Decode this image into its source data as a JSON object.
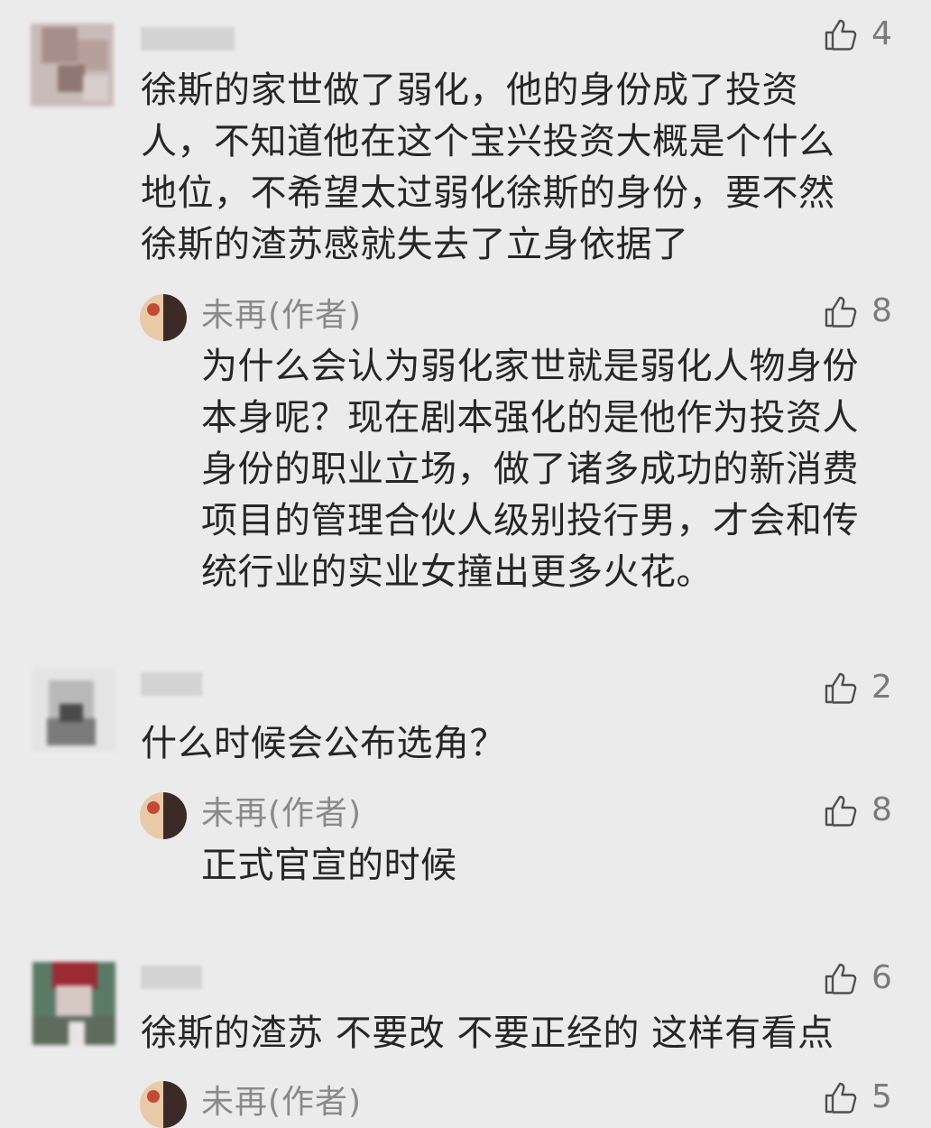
{
  "comments": [
    {
      "text": "徐斯的家世做了弱化，他的身份成了投资人，不知道他在这个宝兴投资大概是个什么地位，不希望太过弱化徐斯的身份，要不然徐斯的渣苏感就失去了立身依据了",
      "lines": [
        "徐斯的家世做了弱化，他的身份成了投资",
        "人，不知道他在这个宝兴投资大概是个什么",
        "地位，不希望太过弱化徐斯的身份，要不然",
        "徐斯的渣苏感就失去了立身依据了"
      ],
      "likes": "4",
      "reply": {
        "author": "未再(作者)",
        "lines": [
          "为什么会认为弱化家世就是弱化人物身份",
          "本身呢？现在剧本强化的是他作为投资人",
          "身份的职业立场，做了诸多成功的新消费",
          "项目的管理合伙人级别投行男，才会和传",
          "统行业的实业女撞出更多火花。"
        ],
        "likes": "8"
      }
    },
    {
      "text": "什么时候会公布选角？",
      "likes": "2",
      "reply": {
        "author": "未再(作者)",
        "text": "正式官宣的时候",
        "likes": "8"
      }
    },
    {
      "text": "徐斯的渣苏 不要改 不要正经的 这样有看点",
      "likes": "6",
      "reply": {
        "author": "未再(作者)",
        "likes": "5"
      }
    }
  ],
  "icons": {
    "like": "thumbs-up-icon"
  },
  "colors": {
    "background": "#ebebeb",
    "text": "#262626",
    "muted": "#8a8a8a"
  }
}
